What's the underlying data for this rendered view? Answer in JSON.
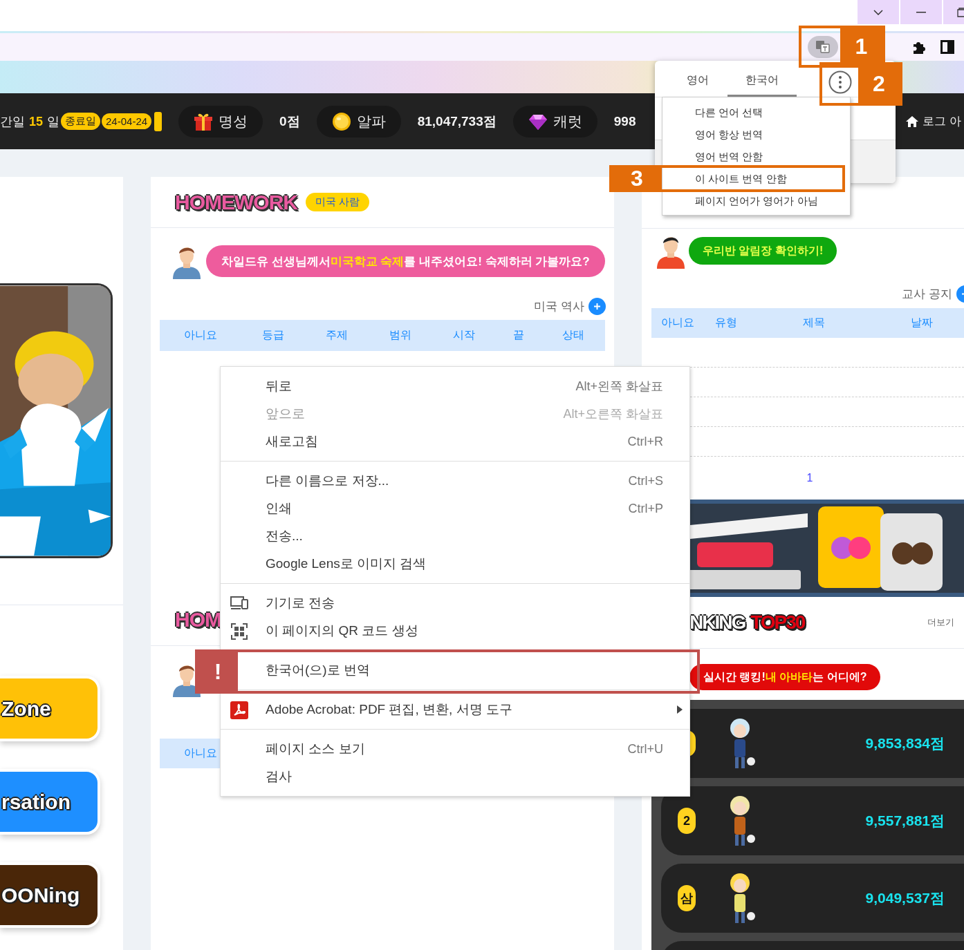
{
  "nav": {
    "period": {
      "prefix": "간일",
      "days": "15",
      "suffix": "일"
    },
    "end_label": "종료일",
    "end_date": "24-04-24",
    "stats": [
      {
        "kind": "gift",
        "label": "명성",
        "value": "0점"
      },
      {
        "kind": "coin",
        "label": "알파",
        "value": "81,047,733점"
      },
      {
        "kind": "gem",
        "label": "캐럿",
        "value": "998"
      }
    ],
    "logout": "로그 아"
  },
  "left_column": {
    "buttons": [
      {
        "label": "Zone",
        "color": "#ffc107"
      },
      {
        "label": "rsation",
        "color": "#1e8fff"
      },
      {
        "label": "OONing",
        "color": "#4a2608"
      }
    ]
  },
  "homework": {
    "logo": "HOMEWORK",
    "badge": "미국 사람",
    "message": [
      {
        "text": "차일드유 선생님께서 ",
        "highlight": false
      },
      {
        "text": "미국학교 숙제",
        "highlight": true
      },
      {
        "text": "를 내주셨어요! 숙제하러 가볼까요?",
        "highlight": false
      }
    ],
    "subject": "미국 역사",
    "columns": [
      "아니요",
      "등급",
      "주제",
      "범위",
      "시작",
      "끝",
      "상태"
    ]
  },
  "homework_2": {
    "logo": "HOM",
    "columns": [
      "아니요"
    ]
  },
  "notice_board": {
    "bubble": "우리반 알림장 확인하기!",
    "title": "교사 공지",
    "columns": [
      "아니요",
      "유형",
      "제목",
      "날짜"
    ],
    "page": "1"
  },
  "ranking": {
    "logo": [
      "NKING",
      "TOP30"
    ],
    "more": "더보기",
    "bubble": [
      {
        "text": "실시간 랭킹! ",
        "highlight": false
      },
      {
        "text": "내 아바타",
        "highlight": true
      },
      {
        "text": "는 어디에?",
        "highlight": false
      }
    ],
    "rows": [
      {
        "score": "9,853,834점"
      },
      {
        "rank": "2",
        "score": "9,557,881점"
      },
      {
        "rank": "삼",
        "score": "9,049,537점"
      }
    ]
  },
  "translate_popup": {
    "tabs": [
      {
        "label": "영어",
        "selected": false
      },
      {
        "label": "한국어",
        "selected": true
      }
    ],
    "options": [
      "다른 언어 선택",
      "영어 항상 번역",
      "영어 번역 안함",
      "이 사이트 번역 안함",
      "페이지 언어가 영어가 아님"
    ]
  },
  "context_menu": {
    "groups": [
      [
        {
          "kind": "plain",
          "label": "뒤로",
          "shortcut": "Alt+왼쪽 화살표",
          "disabled": false,
          "submenu": false
        },
        {
          "kind": "plain",
          "label": "앞으로",
          "shortcut": "Alt+오른쪽 화살표",
          "disabled": true,
          "submenu": false
        },
        {
          "kind": "plain",
          "label": "새로고침",
          "shortcut": "Ctrl+R",
          "disabled": false,
          "submenu": false
        }
      ],
      [
        {
          "kind": "plain",
          "label": "다른 이름으로 저장...",
          "shortcut": "Ctrl+S",
          "disabled": false,
          "submenu": false
        },
        {
          "kind": "plain",
          "label": "인쇄",
          "shortcut": "Ctrl+P",
          "disabled": false,
          "submenu": false
        },
        {
          "kind": "plain",
          "label": "전송...",
          "disabled": false,
          "submenu": false
        },
        {
          "kind": "plain",
          "label": "Google Lens로 이미지 검색",
          "disabled": false,
          "submenu": false
        }
      ],
      [
        {
          "kind": "cast",
          "label": "기기로 전송",
          "disabled": false,
          "submenu": false
        },
        {
          "kind": "qr",
          "label": "이 페이지의 QR 코드 생성",
          "disabled": false,
          "submenu": false
        }
      ],
      [
        {
          "kind": "plain",
          "label": "한국어(으)로 번역",
          "disabled": false,
          "submenu": false
        }
      ],
      [
        {
          "kind": "acrobat",
          "label": "Adobe Acrobat: PDF 편집, 변환, 서명 도구",
          "disabled": false,
          "submenu": true
        }
      ],
      [
        {
          "kind": "plain",
          "label": "페이지 소스 보기",
          "shortcut": "Ctrl+U",
          "disabled": false,
          "submenu": false
        },
        {
          "kind": "plain",
          "label": "검사",
          "disabled": false,
          "submenu": false
        }
      ]
    ]
  },
  "annotations": [
    {
      "label": "1",
      "color": "#e36c0a"
    },
    {
      "label": "2",
      "color": "#e36c0a"
    },
    {
      "label": "3",
      "color": "#e36c0a"
    },
    {
      "label": "!",
      "color": "#c0504d"
    }
  ]
}
